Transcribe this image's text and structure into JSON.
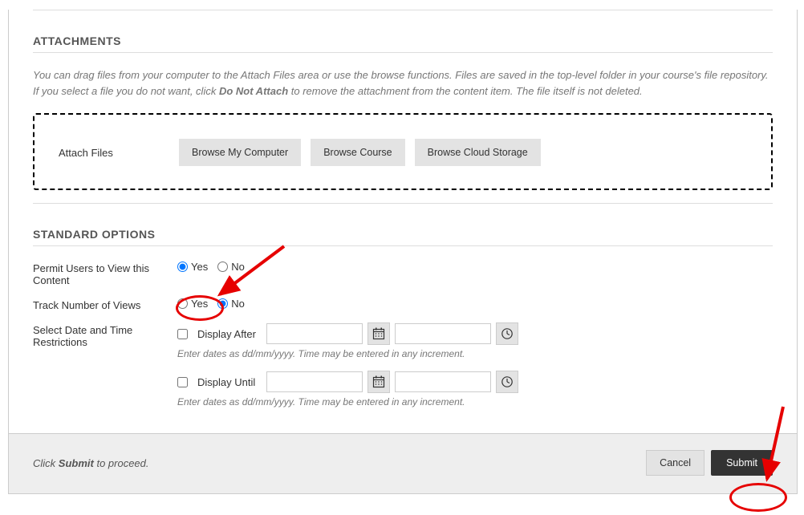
{
  "attachments": {
    "title": "ATTACHMENTS",
    "help_prefix": "You can drag files from your computer to the Attach Files area or use the browse functions. Files are saved in the top-level folder in your course's file repository.  If you select a file you do not want, click ",
    "help_bold": "Do Not Attach",
    "help_suffix": " to remove the attachment from the content item. The file itself is not deleted.",
    "label": "Attach Files",
    "browse_computer": "Browse My Computer",
    "browse_course": "Browse Course",
    "browse_cloud": "Browse Cloud Storage"
  },
  "options": {
    "title": "STANDARD OPTIONS",
    "permit_label": "Permit Users to View this Content",
    "track_label": "Track Number of Views",
    "restrict_label": "Select Date and Time Restrictions",
    "yes": "Yes",
    "no": "No",
    "display_after": "Display After",
    "display_until": "Display Until",
    "date_hint": "Enter dates as dd/mm/yyyy. Time may be entered in any increment."
  },
  "footer": {
    "proceed_prefix": "Click ",
    "proceed_bold": "Submit",
    "proceed_suffix": " to proceed.",
    "cancel": "Cancel",
    "submit": "Submit"
  }
}
